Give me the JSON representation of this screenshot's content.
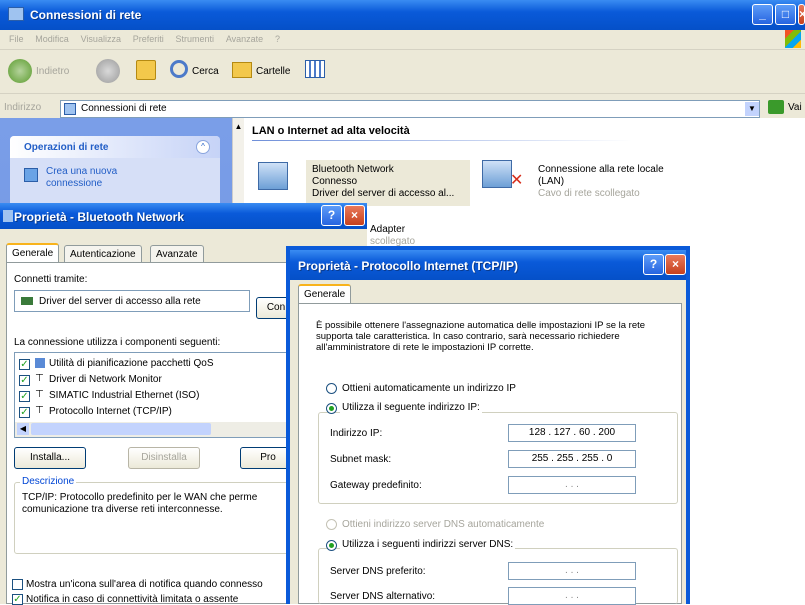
{
  "main_window": {
    "title": "Connessioni di rete",
    "menu": [
      "File",
      "Modifica",
      "Visualizza",
      "Preferiti",
      "Strumenti",
      "Avanzate",
      "?"
    ],
    "toolbar": {
      "back": "Indietro",
      "search": "Cerca",
      "folders": "Cartelle"
    },
    "address_label": "Indirizzo",
    "address_value": "Connessioni di rete",
    "go_label": "Vai",
    "task_header": "Operazioni di rete",
    "task_item": "Crea una nuova connessione",
    "group_title": "LAN o Internet ad alta velocità",
    "connections": [
      {
        "name": "Bluetooth Network",
        "status": "Connesso",
        "device": "Driver del server di accesso al..."
      },
      {
        "name": "Connessione alla rete locale (LAN)",
        "status": "Cavo di rete scollegato"
      }
    ],
    "partial_item": {
      "line1": "Adapter",
      "line2": "scollegato"
    }
  },
  "bt_dialog": {
    "title": "Proprietà - Bluetooth Network",
    "tabs": [
      "Generale",
      "Autenticazione",
      "Avanzate"
    ],
    "connect_using_label": "Connetti tramite:",
    "adapter": "Driver del server di accesso alla rete",
    "configure_button": "Con",
    "components_label": "La connessione utilizza i componenti seguenti:",
    "components": [
      {
        "label": "Utilità di pianificazione pacchetti QoS",
        "checked": true
      },
      {
        "label": "Driver di Network Monitor",
        "checked": true
      },
      {
        "label": "SIMATIC Industrial Ethernet (ISO)",
        "checked": true
      },
      {
        "label": "Protocollo Internet (TCP/IP)",
        "checked": true
      }
    ],
    "install_button": "Installa...",
    "uninstall_button": "Disinstalla",
    "properties_button": "Pro",
    "description_caption": "Descrizione",
    "description_text": "TCP/IP: Protocollo predefinito per le WAN che perme comunicazione tra diverse reti interconnesse.",
    "show_icon_label": "Mostra un'icona sull'area di notifica quando connesso",
    "notify_label": "Notifica in caso di connettività limitata o assente",
    "show_icon_checked": false,
    "notify_checked": true
  },
  "tcp_dialog": {
    "title": "Proprietà - Protocollo Internet (TCP/IP)",
    "tab": "Generale",
    "intro": "È possibile ottenere l'assegnazione automatica delle impostazioni IP se la rete supporta tale caratteristica. In caso contrario, sarà necessario richiedere all'amministratore di rete le impostazioni IP corrette.",
    "auto_ip_label": "Ottieni automaticamente un indirizzo IP",
    "manual_ip_label": "Utilizza il seguente indirizzo IP:",
    "ip_label": "Indirizzo IP:",
    "ip_value": "128 . 127 . 60 . 200",
    "subnet_label": "Subnet mask:",
    "subnet_value": "255 . 255 . 255 . 0",
    "gateway_label": "Gateway predefinito:",
    "gateway_value": ". . .",
    "auto_dns_label": "Ottieni indirizzo server DNS automaticamente",
    "manual_dns_label": "Utilizza i seguenti indirizzi server DNS:",
    "pref_dns_label": "Server DNS preferito:",
    "alt_dns_label": "Server DNS alternativo:",
    "dns_value": ". . ."
  }
}
